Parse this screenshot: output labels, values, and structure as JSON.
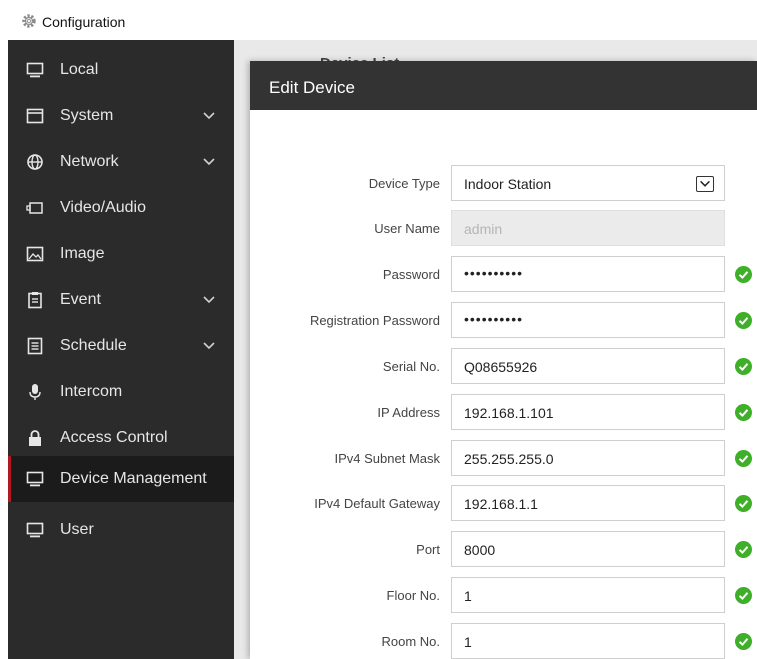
{
  "app": {
    "title": "Configuration"
  },
  "sidebar": {
    "items": [
      {
        "label": "Local"
      },
      {
        "label": "System"
      },
      {
        "label": "Network"
      },
      {
        "label": "Video/Audio"
      },
      {
        "label": "Image"
      },
      {
        "label": "Event"
      },
      {
        "label": "Schedule"
      },
      {
        "label": "Intercom"
      },
      {
        "label": "Access Control"
      },
      {
        "label": "Device Management",
        "active": true
      },
      {
        "label": "User"
      }
    ]
  },
  "background_page": {
    "title": "Device List"
  },
  "dialog": {
    "title": "Edit Device",
    "fields": [
      {
        "label": "Device Type",
        "value": "Indoor Station",
        "type": "select"
      },
      {
        "label": "User Name",
        "placeholder": "admin",
        "disabled": true
      },
      {
        "label": "Password",
        "value": "••••••••••",
        "valid": true
      },
      {
        "label": "Registration Password",
        "value": "••••••••••",
        "valid": true
      },
      {
        "label": "Serial No.",
        "value": "Q08655926",
        "valid": true
      },
      {
        "label": "IP Address",
        "value": "192.168.1.101",
        "valid": true
      },
      {
        "label": "IPv4 Subnet Mask",
        "value": "255.255.255.0",
        "valid": true
      },
      {
        "label": "IPv4 Default Gateway",
        "value": "192.168.1.1",
        "valid": true
      },
      {
        "label": "Port",
        "value": "8000",
        "valid": true
      },
      {
        "label": "Floor No.",
        "value": "1",
        "valid": true
      },
      {
        "label": "Room No.",
        "value": "1",
        "valid": true
      }
    ]
  },
  "colors": {
    "sidebar_bg": "#2b2b2b",
    "active_accent": "#b01822",
    "valid_check": "#3fae29",
    "dialog_header": "#333333"
  }
}
